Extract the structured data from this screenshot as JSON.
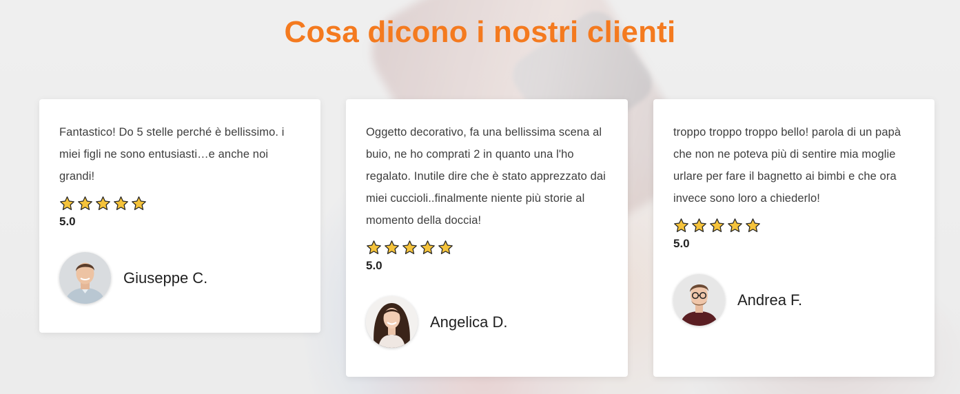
{
  "section": {
    "title": "Cosa dicono i nostri clienti"
  },
  "accent_color": "#f47a1f",
  "star_color": "#f5c33b",
  "testimonials": [
    {
      "text": "Fantastico! Do 5 stelle perché è bellissimo. i miei figli ne sono entusiasti…e anche noi grandi!",
      "stars": 5,
      "rating": "5.0",
      "author": "Giuseppe C.",
      "avatar_icon": "man-avatar-icon"
    },
    {
      "text": "Oggetto decorativo, fa una bellissima scena al buio, ne ho comprati 2 in quanto una l'ho regalato. Inutile dire che è stato apprezzato dai miei cuccioli..finalmente niente più storie al momento della doccia!",
      "stars": 5,
      "rating": "5.0",
      "author": "Angelica D.",
      "avatar_icon": "woman-avatar-icon"
    },
    {
      "text": "troppo troppo troppo bello! parola di un papà che non ne poteva più di sentire mia moglie urlare per fare il bagnetto ai bimbi e che ora invece sono loro a chiederlo!",
      "stars": 5,
      "rating": "5.0",
      "author": "Andrea F.",
      "avatar_icon": "man-glasses-avatar-icon"
    }
  ]
}
